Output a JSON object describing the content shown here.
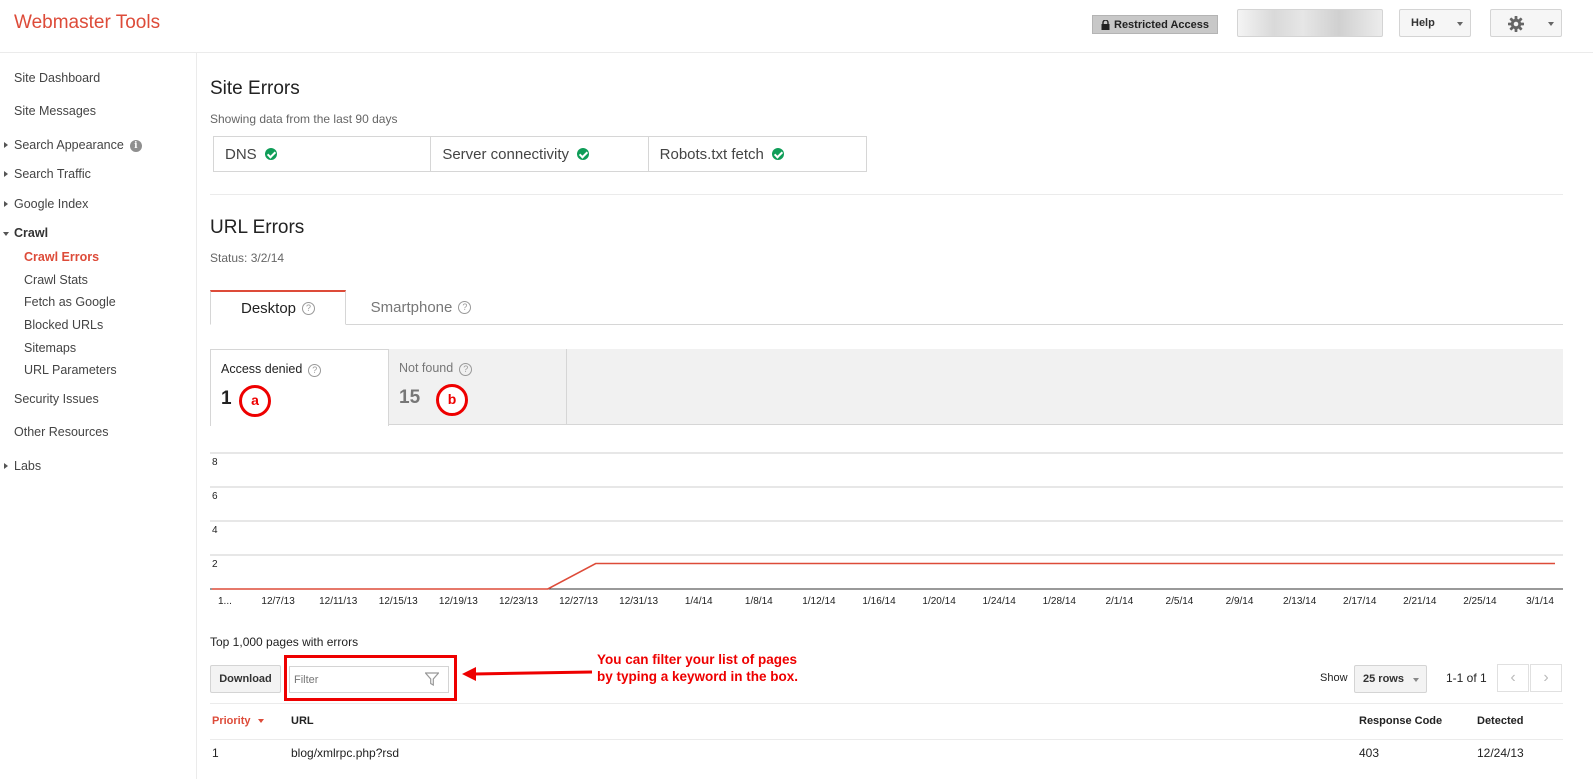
{
  "header": {
    "app_title": "Webmaster Tools",
    "restricted_label": "Restricted Access",
    "help_label": "Help"
  },
  "sidebar": {
    "items": [
      {
        "label": "Site Dashboard"
      },
      {
        "label": "Site Messages"
      },
      {
        "label": "Search Appearance"
      },
      {
        "label": "Search Traffic"
      },
      {
        "label": "Google Index"
      },
      {
        "label": "Crawl"
      },
      {
        "label": "Crawl Errors",
        "active": true
      },
      {
        "label": "Crawl Stats"
      },
      {
        "label": "Fetch as Google"
      },
      {
        "label": "Blocked URLs"
      },
      {
        "label": "Sitemaps"
      },
      {
        "label": "URL Parameters"
      },
      {
        "label": "Security Issues"
      },
      {
        "label": "Other Resources"
      },
      {
        "label": "Labs"
      }
    ],
    "info_glyph": "i"
  },
  "site_errors": {
    "title": "Site Errors",
    "subtitle": "Showing data from the last 90 days",
    "checks": [
      {
        "label": "DNS",
        "status": "ok"
      },
      {
        "label": "Server connectivity",
        "status": "ok"
      },
      {
        "label": "Robots.txt fetch",
        "status": "ok"
      }
    ]
  },
  "url_errors": {
    "title": "URL Errors",
    "status": "Status: 3/2/14",
    "tabs": [
      {
        "label": "Desktop",
        "active": true
      },
      {
        "label": "Smartphone"
      }
    ],
    "help_glyph": "?",
    "types": [
      {
        "label": "Access denied",
        "count": "1",
        "marker": "a",
        "active": true
      },
      {
        "label": "Not found",
        "count": "15",
        "marker": "b"
      }
    ]
  },
  "chart_data": {
    "type": "line",
    "series": [
      {
        "values": [
          0,
          0,
          0,
          0,
          0,
          0,
          0,
          0,
          1,
          1,
          1,
          1,
          1,
          1,
          1,
          1,
          1,
          1,
          1,
          1,
          1,
          1,
          1,
          1,
          1,
          1,
          1,
          1,
          1
        ]
      }
    ],
    "x_tick_labels": [
      "1...",
      "12/7/13",
      "12/11/13",
      "12/15/13",
      "12/19/13",
      "12/23/13",
      "12/27/13",
      "12/31/13",
      "1/4/14",
      "1/8/14",
      "1/12/14",
      "1/16/14",
      "1/20/14",
      "1/24/14",
      "1/28/14",
      "2/1/14",
      "2/5/14",
      "2/9/14",
      "2/13/14",
      "2/17/14",
      "2/21/14",
      "2/25/14",
      "3/1/14"
    ],
    "y_tick_labels": [
      "8",
      "6",
      "4",
      "2"
    ],
    "ylim": [
      0,
      8
    ],
    "grid": true,
    "color": "#dd4b39"
  },
  "table_area": {
    "heading": "Top 1,000 pages with errors",
    "download_label": "Download",
    "filter_placeholder": "Filter",
    "annotation_line1": "You can filter your list of pages",
    "annotation_line2": "by typing a keyword in the box.",
    "show_label": "Show",
    "rows_label": "25 rows",
    "page_info": "1-1 of 1",
    "prev_glyph": "‹",
    "next_glyph": "›",
    "columns": {
      "priority": "Priority",
      "url": "URL",
      "response_code": "Response Code",
      "detected": "Detected"
    },
    "rows": [
      {
        "priority": "1",
        "url": "blog/xmlrpc.php?rsd",
        "response_code": "403",
        "detected": "12/24/13"
      }
    ]
  },
  "colors": {
    "brand_red": "#dd4b39",
    "ok_green": "#0f9d58",
    "annotation_red": "#ee0000"
  }
}
